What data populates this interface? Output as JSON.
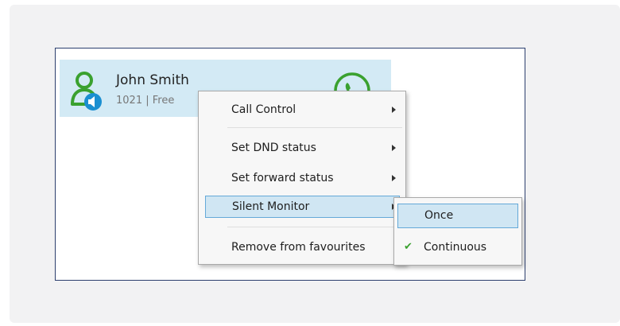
{
  "contact": {
    "name": "John Smith",
    "status": "1021 | Free",
    "avatar_icon": "person-icon",
    "call_icon": "phone-icon"
  },
  "context_menu": {
    "items": [
      {
        "label": "Call Control",
        "has_submenu": true
      },
      {
        "label": "Set DND status",
        "has_submenu": true
      },
      {
        "label": "Set forward status",
        "has_submenu": true
      },
      {
        "label": "Silent Monitor",
        "has_submenu": true,
        "highlighted": true
      },
      {
        "label": "Remove from favourites",
        "has_submenu": false
      }
    ]
  },
  "silent_monitor_submenu": {
    "items": [
      {
        "label": "Once",
        "highlighted": true,
        "checked": false
      },
      {
        "label": "Continuous",
        "highlighted": false,
        "checked": true
      }
    ]
  },
  "colors": {
    "accent_green": "#3aa12f",
    "selection_blue": "#d3eaf5",
    "badge_blue": "#1b8fd1"
  }
}
